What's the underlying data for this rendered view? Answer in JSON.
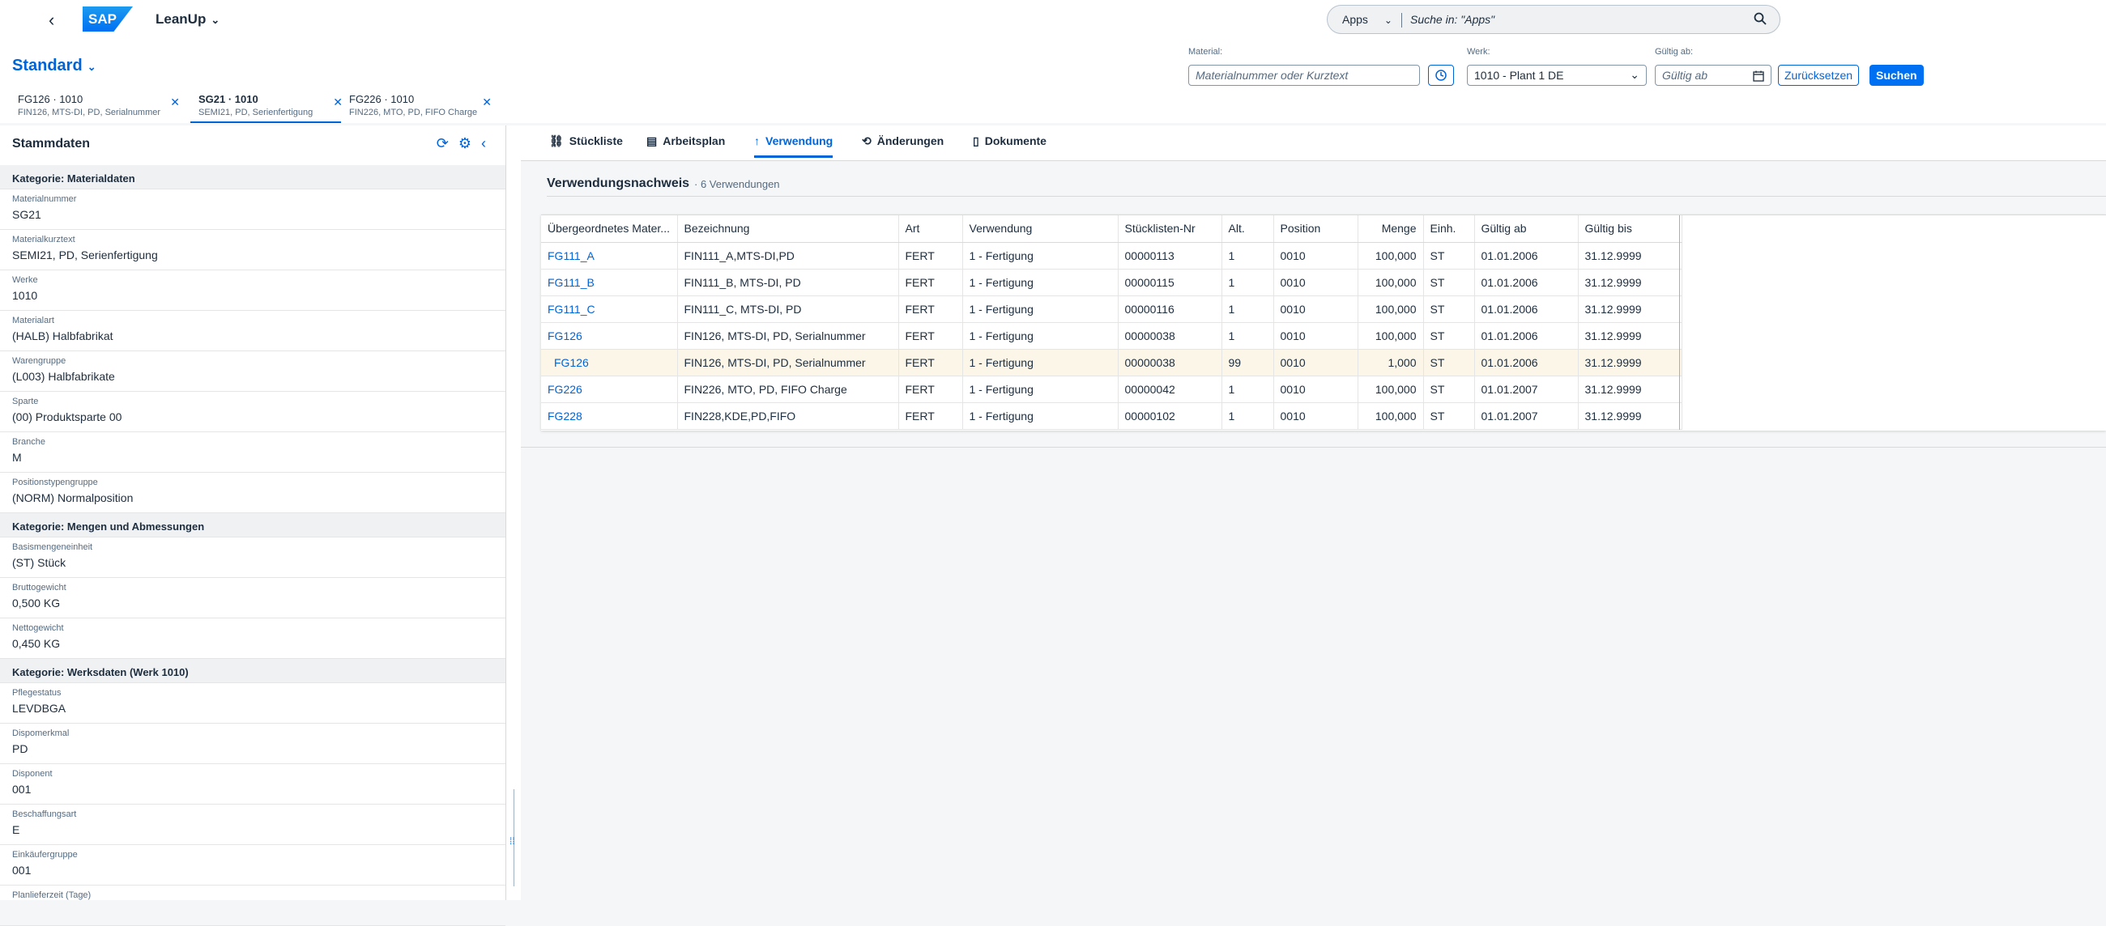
{
  "shell": {
    "app_title": "LeanUp",
    "logo_text": "SAP",
    "search_scope": "Apps",
    "search_placeholder": "Suche in: \"Apps\""
  },
  "header": {
    "variant": "Standard",
    "filters": {
      "material_label": "Material:",
      "material_placeholder": "Materialnummer oder Kurztext",
      "werk_label": "Werk:",
      "werk_value": "1010 - Plant 1 DE",
      "gueltig_label": "Gültig ab:",
      "gueltig_placeholder": "Gültig ab",
      "reset_label": "Zurücksetzen",
      "search_label": "Suchen"
    },
    "doc_tabs": [
      {
        "title": "FG126 · 1010",
        "subtitle": "FIN126, MTS-DI, PD, Serialnummer"
      },
      {
        "title": "SG21 · 1010",
        "subtitle": "SEMI21, PD, Serienfertigung"
      },
      {
        "title": "FG226 · 1010",
        "subtitle": "FIN226, MTO, PD, FIFO Charge"
      }
    ]
  },
  "left": {
    "title": "Stammdaten",
    "categories": [
      {
        "title": "Kategorie: Materialdaten",
        "fields": [
          {
            "label": "Materialnummer",
            "value": "SG21"
          },
          {
            "label": "Materialkurztext",
            "value": "SEMI21, PD, Serienfertigung"
          },
          {
            "label": "Werke",
            "value": "1010"
          },
          {
            "label": "Materialart",
            "value": "(HALB) Halbfabrikat"
          },
          {
            "label": "Warengruppe",
            "value": "(L003) Halbfabrikate"
          },
          {
            "label": "Sparte",
            "value": "(00) Produktsparte 00"
          },
          {
            "label": "Branche",
            "value": "M"
          },
          {
            "label": "Positionstypengruppe",
            "value": "(NORM) Normalposition"
          }
        ]
      },
      {
        "title": "Kategorie: Mengen und Abmessungen",
        "fields": [
          {
            "label": "Basismengeneinheit",
            "value": "(ST) Stück"
          },
          {
            "label": "Bruttogewicht",
            "value": "0,500 KG"
          },
          {
            "label": "Nettogewicht",
            "value": "0,450 KG"
          }
        ]
      },
      {
        "title": "Kategorie: Werksdaten (Werk 1010)",
        "fields": [
          {
            "label": "Pflegestatus",
            "value": "LEVDBGA"
          },
          {
            "label": "Dispomerkmal",
            "value": "PD"
          },
          {
            "label": "Disponent",
            "value": "001"
          },
          {
            "label": "Beschaffungsart",
            "value": "E"
          },
          {
            "label": "Einkäufergruppe",
            "value": "001"
          },
          {
            "label": "Planlieferzeit (Tage)",
            "value": ""
          }
        ]
      }
    ]
  },
  "tabs": [
    {
      "label": "Stückliste",
      "icon": "hierarchy-icon"
    },
    {
      "label": "Arbeitsplan",
      "icon": "factory-icon"
    },
    {
      "label": "Verwendung",
      "icon": "arrow-up-icon"
    },
    {
      "label": "Änderungen",
      "icon": "history-icon"
    },
    {
      "label": "Dokumente",
      "icon": "document-icon"
    }
  ],
  "panel": {
    "title": "Verwendungsnachweis",
    "count": "· 6 Verwendungen"
  },
  "table": {
    "columns": [
      "Übergeordnetes Mater...",
      "Bezeichnung",
      "Art",
      "Verwendung",
      "Stücklisten-Nr",
      "Alt.",
      "Position",
      "Menge",
      "Einh.",
      "Gültig ab",
      "Gültig bis"
    ],
    "rows": [
      [
        "FG111_A",
        "FIN111_A,MTS-DI,PD",
        "FERT",
        "1 - Fertigung",
        "00000113",
        "1",
        "0010",
        "100,000",
        "ST",
        "01.01.2006",
        "31.12.9999"
      ],
      [
        "FG111_B",
        "FIN111_B, MTS-DI, PD",
        "FERT",
        "1 - Fertigung",
        "00000115",
        "1",
        "0010",
        "100,000",
        "ST",
        "01.01.2006",
        "31.12.9999"
      ],
      [
        "FG111_C",
        "FIN111_C, MTS-DI, PD",
        "FERT",
        "1 - Fertigung",
        "00000116",
        "1",
        "0010",
        "100,000",
        "ST",
        "01.01.2006",
        "31.12.9999"
      ],
      [
        "FG126",
        "FIN126, MTS-DI, PD, Serialnummer",
        "FERT",
        "1 - Fertigung",
        "00000038",
        "1",
        "0010",
        "100,000",
        "ST",
        "01.01.2006",
        "31.12.9999"
      ],
      [
        "FG126",
        "FIN126, MTS-DI, PD, Serialnummer",
        "FERT",
        "1 - Fertigung",
        "00000038",
        "99",
        "0010",
        "1,000",
        "ST",
        "01.01.2006",
        "31.12.9999"
      ],
      [
        "FG226",
        "FIN226, MTO, PD, FIFO Charge",
        "FERT",
        "1 - Fertigung",
        "00000042",
        "1",
        "0010",
        "100,000",
        "ST",
        "01.01.2007",
        "31.12.9999"
      ],
      [
        "FG228",
        "FIN228,KDE,PD,FIFO",
        "FERT",
        "1 - Fertigung",
        "00000102",
        "1",
        "0010",
        "100,000",
        "ST",
        "01.01.2007",
        "31.12.9999"
      ]
    ],
    "highlighted_row": 4
  },
  "colors": {
    "accent": "#0064d9",
    "emphasized": "#0070f2",
    "highlight_row": "#fbf6e8"
  }
}
